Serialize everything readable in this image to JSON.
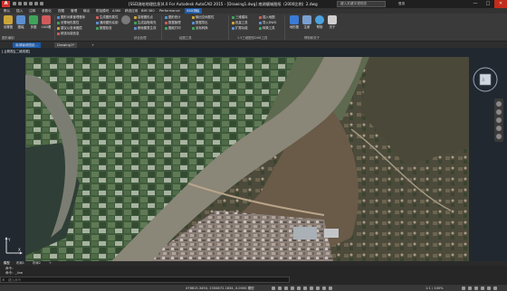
{
  "window": {
    "title": "[SSD测绘地理信息]4.0 For Autodesk AutoCAD 2015 - [Drawing1.dwg]   南湖塘城图纸（2000比例）2.dwg",
    "search_placeholder": "键入关键字或短语",
    "user": "登录",
    "min": "—",
    "max": "□",
    "close": "✕"
  },
  "menu": [
    "默认",
    "插入",
    "注释",
    "参数化",
    "视图",
    "管理",
    "输出",
    "附加模块",
    "A360",
    "精选应用",
    "BIM 360",
    "Performance",
    "SSD测绘"
  ],
  "ribbon": {
    "big_buttons": [
      {
        "label": "设置图",
        "color": "#c9a43a"
      },
      {
        "label": "图幅",
        "color": "#5a8fd0"
      },
      {
        "label": "多图",
        "color": "#3fa35b"
      },
      {
        "label": "CAD看",
        "color": "#d05a5a"
      }
    ],
    "col1": [
      "图形对象管理程序",
      "设置地形属性",
      "建议以查询图层",
      "精选功能信息"
    ],
    "col2": [
      "生成图形属性",
      "通用图形绘制",
      "数据检查"
    ],
    "col3": [
      "高程图形点",
      "生成高程填充",
      "断面图表生成"
    ],
    "col4": [
      "图形统计",
      "数据管理",
      "图纸打印"
    ],
    "col5": [
      "输出空间属性",
      "数据导出",
      "坐标转换"
    ],
    "col6": [
      "三维模拟",
      "批量工具",
      "扩展功能"
    ],
    "col7": [
      "插入地图",
      "导入DWG",
      "转换工具"
    ],
    "right_buttons": [
      {
        "label": "地形图",
        "color": "#3a7bd5"
      },
      {
        "label": "注册",
        "color": "#7aa0d0"
      },
      {
        "label": "帮助",
        "color": "#4aa3df"
      },
      {
        "label": "关于",
        "color": "#d0d0d0"
      }
    ],
    "panel_labels": [
      "图形编制",
      "综合处理",
      "绘图工具",
      "1.5三维图形DHB工具",
      "帮助和关于"
    ]
  },
  "tabs": {
    "doc1": "南湖塘城图纸...",
    "doc2": "Drawing1*",
    "add": "+"
  },
  "viewport": {
    "label": "[-][俯视][二维线框]",
    "viewcube_label": "上",
    "ucs_y": "Y",
    "ucs_x": "X"
  },
  "layout_tabs": [
    "模型",
    "布局1",
    "布局2",
    "+"
  ],
  "command": {
    "line1": "命令：",
    "line2": "命令：_line",
    "placeholder": "键入命令"
  },
  "status": {
    "model": "模型",
    "coords": "476615.3450, 2334672.1834, 0.0000  模型",
    "scale": "1:1 / 100%"
  }
}
